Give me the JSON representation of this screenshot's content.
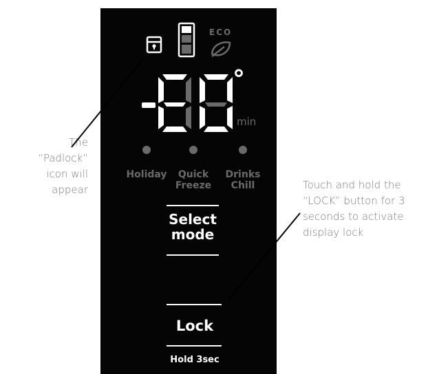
{
  "annotations": {
    "padlock_note": [
      "The",
      "“Padlock”",
      "icon will",
      "appear"
    ],
    "lock_note": [
      "Touch and hold the",
      "“LOCK” button for 3",
      "seconds to activate",
      "display lock"
    ]
  },
  "display": {
    "eco_label": "ECO",
    "minus_sign": "-",
    "digits_shown": "88",
    "degree_symbol": "°",
    "unit_label": "min"
  },
  "modes": [
    {
      "label_line1": "Holiday",
      "label_line2": ""
    },
    {
      "label_line1": "Quick",
      "label_line2": "Freeze"
    },
    {
      "label_line1": "Drinks",
      "label_line2": "Chill"
    }
  ],
  "buttons": {
    "select_mode": {
      "line1": "Select",
      "line2": "mode"
    },
    "lock": {
      "label": "Lock",
      "sublabel": "Hold 3sec"
    }
  },
  "colors": {
    "panel": "#050505",
    "lit_segment": "#ffffff",
    "dim_segment": "#6a6a6a",
    "callout_text": "#7d7d7d"
  },
  "icons": [
    "padlock-icon",
    "fridge-temperature-icon",
    "leaf-icon"
  ]
}
